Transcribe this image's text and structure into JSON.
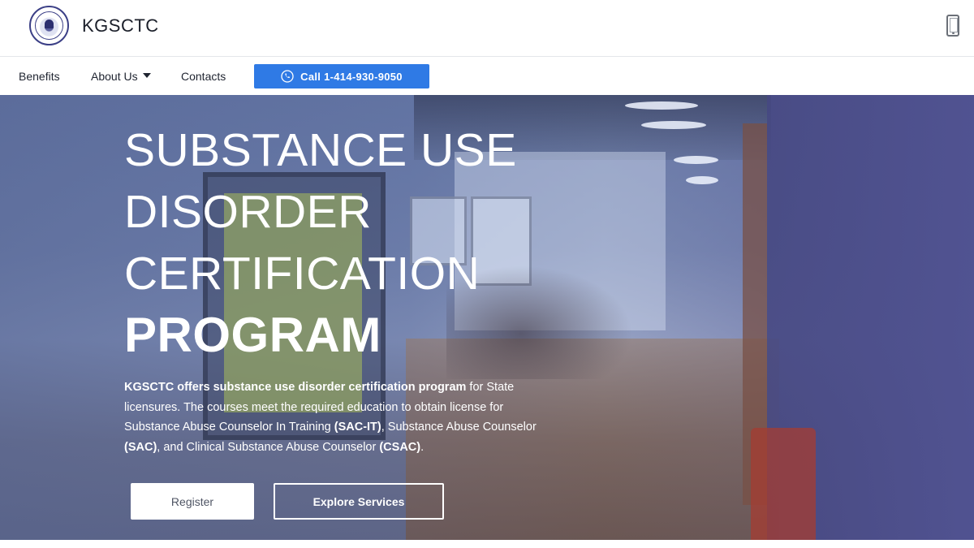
{
  "header": {
    "brand": "KGSCTC",
    "logo_icon": "seal-logo-icon",
    "phone_icon": "mobile-phone-icon"
  },
  "nav": {
    "items": [
      {
        "label": "Benefits"
      },
      {
        "label": "About Us",
        "has_dropdown": true
      },
      {
        "label": "Contacts"
      }
    ],
    "call_button": {
      "label": "Call 1-414-930-9050",
      "icon": "phone-call-icon",
      "color": "#2f7ae5"
    }
  },
  "hero": {
    "title_lines": [
      "SUBSTANCE USE",
      "DISORDER",
      "CERTIFICATION"
    ],
    "title_bold": "PROGRAM",
    "description": {
      "p1_bold": "KGSCTC offers substance use disorder certification program",
      "p2": " for State licensures. The courses meet the required education to obtain license for Substance Abuse Counselor In Training ",
      "p3_bold": "(SAC-IT)",
      "p4": ", Substance Abuse Counselor ",
      "p5_bold": "(SAC)",
      "p6": ", and Clinical Substance Abuse Counselor ",
      "p7_bold": "(CSAC)",
      "p8": "."
    },
    "buttons": {
      "register": "Register",
      "explore": "Explore Services"
    }
  }
}
